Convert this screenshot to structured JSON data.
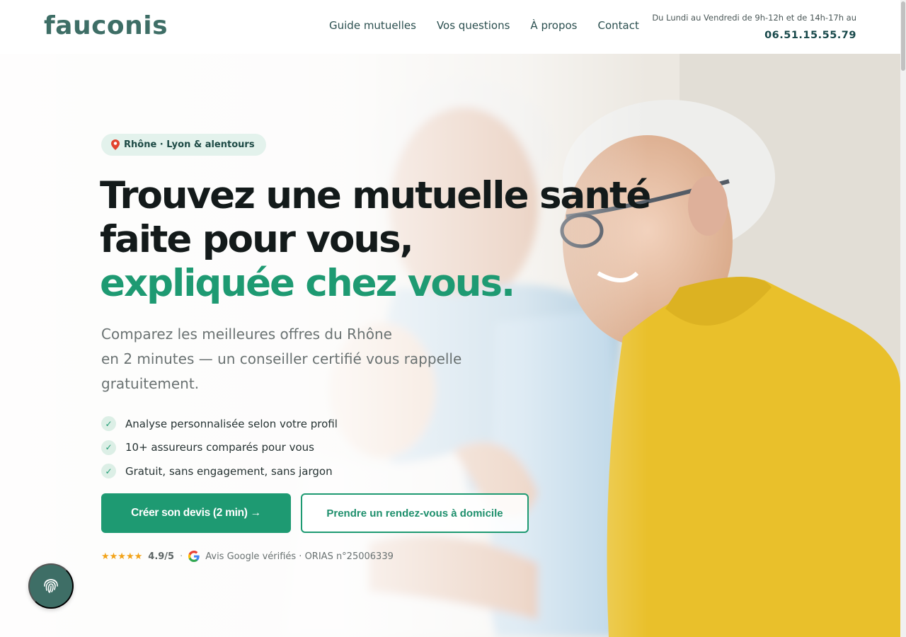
{
  "brand": {
    "logo_text": "fauconis",
    "color_primary": "#1e9a72",
    "color_dark": "#3e6e66"
  },
  "nav": {
    "items": [
      {
        "label": "Guide mutuelles"
      },
      {
        "label": "Vos questions"
      },
      {
        "label": "À propos"
      },
      {
        "label": "Contact"
      }
    ]
  },
  "contact": {
    "hours": "Du Lundi au Vendredi de 9h-12h et de 14h-17h au",
    "phone": "06.51.15.55.79"
  },
  "hero": {
    "badge": "Rhône · Lyon & alentours",
    "badge_icon": "pin-icon",
    "headline_line1": "Trouvez une mutuelle santé",
    "headline_line2": "faite pour vous,",
    "headline_line3": "expliquée chez vous.",
    "subtitle_line1": "Comparez les meilleures offres du Rhône",
    "subtitle_line2": "en 2 minutes — un conseiller certifié vous rappelle",
    "subtitle_line3": "gratuitement.",
    "checks": [
      "Analyse personnalisée selon votre profil",
      "10+ assureurs comparés pour vous",
      "Gratuit, sans engagement, sans jargon"
    ],
    "cta_primary": "Créer son devis (2 min) →",
    "cta_secondary": "Prendre un rendez-vous à domicile",
    "rating": {
      "stars": "★★★★★",
      "stars_value": 5,
      "score": "4.9/5",
      "separator": "·",
      "reviews_text": "Avis Google vérifiés · ORIAS n°25006339"
    }
  },
  "fab": {
    "icon": "fingerprint-icon"
  }
}
